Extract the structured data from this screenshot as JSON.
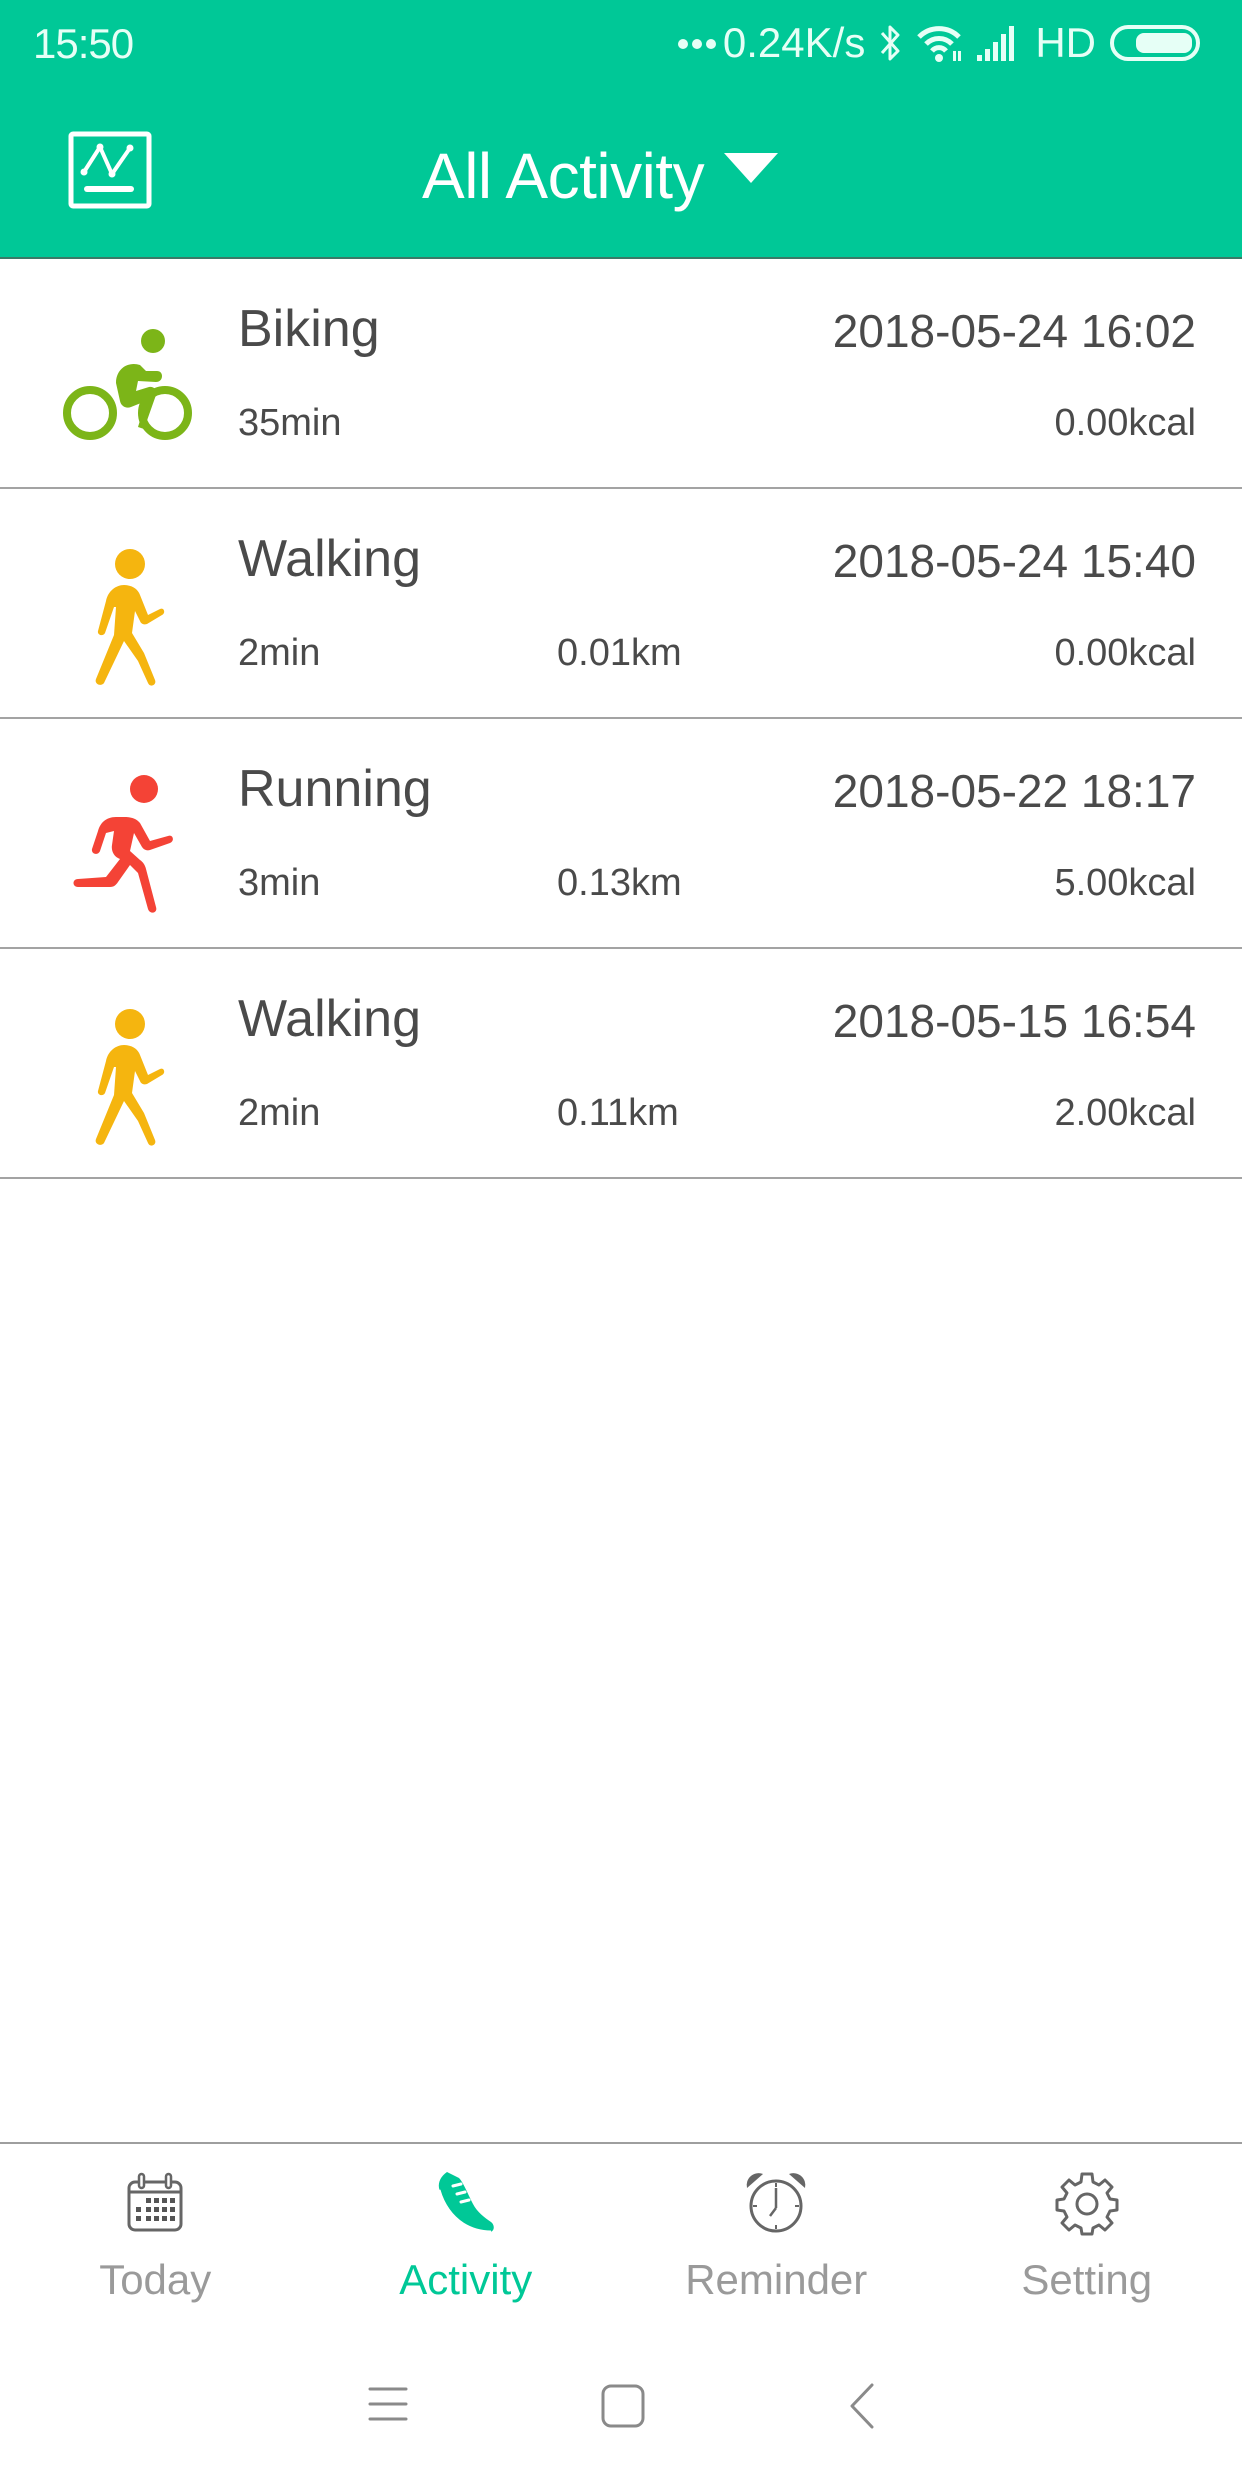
{
  "status_bar": {
    "time": "15:50",
    "network_speed": "0.24K/s",
    "network_type": "HD",
    "icons": [
      "more-dots-icon",
      "bluetooth-icon",
      "wifi-icon",
      "signal-icon",
      "battery-icon"
    ],
    "battery_level": 0.9
  },
  "header": {
    "left_icon": "chart-icon",
    "title": "All Activity",
    "dropdown_icon": "caret-down-icon"
  },
  "colors": {
    "brand": "#00C897",
    "biking": "#7CB518",
    "walking": "#F5B50F",
    "running": "#F44336",
    "text": "#4a4a4a",
    "tab_inactive": "#9a9a9a"
  },
  "activities": [
    {
      "type": "Biking",
      "icon": "biking-icon",
      "datetime": "2018-05-24 16:02",
      "duration": "35min",
      "distance": "",
      "calories": "0.00kcal"
    },
    {
      "type": "Walking",
      "icon": "walking-icon",
      "datetime": "2018-05-24 15:40",
      "duration": "2min",
      "distance": "0.01km",
      "calories": "0.00kcal"
    },
    {
      "type": "Running",
      "icon": "running-icon",
      "datetime": "2018-05-22 18:17",
      "duration": "3min",
      "distance": "0.13km",
      "calories": "5.00kcal"
    },
    {
      "type": "Walking",
      "icon": "walking-icon",
      "datetime": "2018-05-15 16:54",
      "duration": "2min",
      "distance": "0.11km",
      "calories": "2.00kcal"
    }
  ],
  "tabs": [
    {
      "label": "Today",
      "icon": "calendar-icon",
      "active": false
    },
    {
      "label": "Activity",
      "icon": "shoe-icon",
      "active": true
    },
    {
      "label": "Reminder",
      "icon": "alarm-clock-icon",
      "active": false
    },
    {
      "label": "Setting",
      "icon": "gear-icon",
      "active": false
    }
  ],
  "system_nav": [
    "menu-icon",
    "home-icon",
    "back-icon"
  ]
}
